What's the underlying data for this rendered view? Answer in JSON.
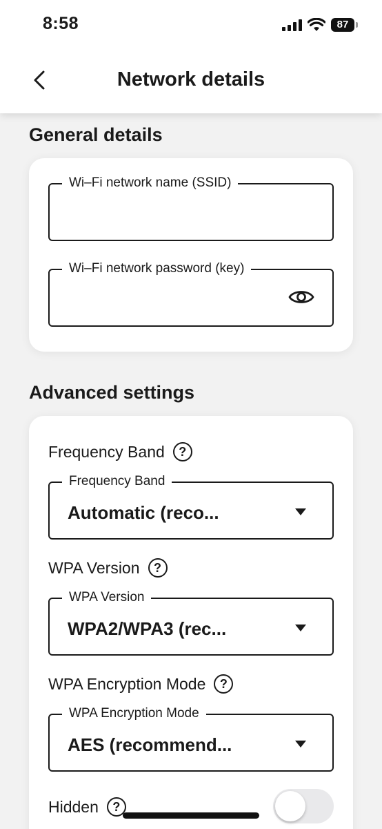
{
  "status_bar": {
    "time": "8:58",
    "battery": "87",
    "icons": [
      "signal-icon",
      "wifi-icon",
      "battery-icon"
    ]
  },
  "header": {
    "title": "Network details",
    "back_icon": "chevron-left-icon"
  },
  "general": {
    "title": "General details",
    "ssid": {
      "label": "Wi–Fi network name (SSID)",
      "value": ""
    },
    "password": {
      "label": "Wi–Fi network password (key)",
      "value": "",
      "icon": "eye-icon"
    }
  },
  "advanced": {
    "title": "Advanced settings",
    "frequency": {
      "row_label": "Frequency Band",
      "field_label": "Frequency Band",
      "selected": "Automatic (reco..."
    },
    "wpa_version": {
      "row_label": "WPA Version",
      "field_label": "WPA Version",
      "selected": "WPA2/WPA3 (rec..."
    },
    "encryption": {
      "row_label": "WPA Encryption Mode",
      "field_label": "WPA Encryption Mode",
      "selected": "AES (recommend..."
    },
    "hidden": {
      "label": "Hidden",
      "enabled": false
    }
  },
  "help_glyph": "?",
  "colors": {
    "text": "#1a1a1a",
    "background": "#f2f2f2",
    "card": "#ffffff",
    "toggle_off": "#e9e9eb"
  }
}
